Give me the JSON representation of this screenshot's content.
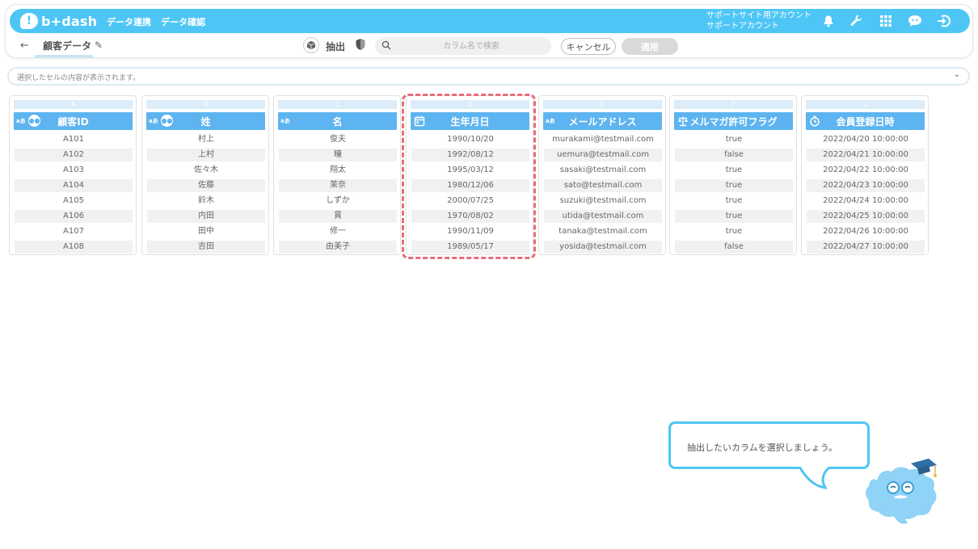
{
  "app": {
    "logo_text": "b+dash",
    "nav": [
      "データ連携",
      "データ確認"
    ],
    "account_line1": "サポートサイト用アカウント",
    "account_line2": "サポートアカウント"
  },
  "toolbar": {
    "page_title": "顧客データ",
    "extract_label": "抽出",
    "search_placeholder": "カラム名で検索",
    "cancel_label": "キャンセル",
    "apply_label": "適用"
  },
  "cellbar": {
    "text": "選択したセルの内容が表示されます。"
  },
  "columns": [
    {
      "letter": "A",
      "type_badge": "aあ",
      "grouped": true,
      "icon": "text-icon",
      "name": "顧客ID",
      "values": [
        "A101",
        "A102",
        "A103",
        "A104",
        "A105",
        "A106",
        "A107",
        "A108"
      ]
    },
    {
      "letter": "B",
      "type_badge": "aあ",
      "grouped": true,
      "icon": "text-icon",
      "name": "姓",
      "values": [
        "村上",
        "上村",
        "佐々木",
        "佐藤",
        "鈴木",
        "内田",
        "田中",
        "吉田"
      ]
    },
    {
      "letter": "C",
      "type_badge": "aあ",
      "grouped": false,
      "icon": "text-icon",
      "name": "名",
      "values": [
        "俊夫",
        "瞳",
        "翔太",
        "茉奈",
        "しずか",
        "貫",
        "修一",
        "由美子"
      ]
    },
    {
      "letter": "D",
      "type_badge": "",
      "grouped": false,
      "icon": "calendar-icon",
      "name": "生年月日",
      "values": [
        "1990/10/20",
        "1992/08/12",
        "1995/03/12",
        "1980/12/06",
        "2000/07/25",
        "1970/08/02",
        "1990/11/09",
        "1989/05/17"
      ]
    },
    {
      "letter": "E",
      "type_badge": "aあ",
      "grouped": false,
      "icon": "text-icon",
      "name": "メールアドレス",
      "values": [
        "murakami@testmail.com",
        "uemura@testmail.com",
        "sasaki@testmail.com",
        "sato@testmail.com",
        "suzuki@testmail.com",
        "utida@testmail.com",
        "tanaka@testmail.com",
        "yosida@testmail.com"
      ]
    },
    {
      "letter": "F",
      "type_badge": "",
      "grouped": false,
      "icon": "scale-icon",
      "name": "メルマガ許可フラグ",
      "values": [
        "true",
        "false",
        "true",
        "true",
        "true",
        "true",
        "true",
        "false"
      ]
    },
    {
      "letter": "G",
      "type_badge": "",
      "grouped": false,
      "icon": "clock-icon",
      "name": "会員登録日時",
      "values": [
        "2022/04/20 10:00:00",
        "2022/04/21 10:00:00",
        "2022/04/22 10:00:00",
        "2022/04/23 10:00:00",
        "2022/04/24 10:00:00",
        "2022/04/25 10:00:00",
        "2022/04/26 10:00:00",
        "2022/04/27 10:00:00"
      ]
    }
  ],
  "tooltip": {
    "text": "抽出したいカラムを選択しましょう。"
  },
  "colors": {
    "brand": "#4ec6f5",
    "header": "#5eb4f0",
    "highlight": "#ea6b78"
  }
}
